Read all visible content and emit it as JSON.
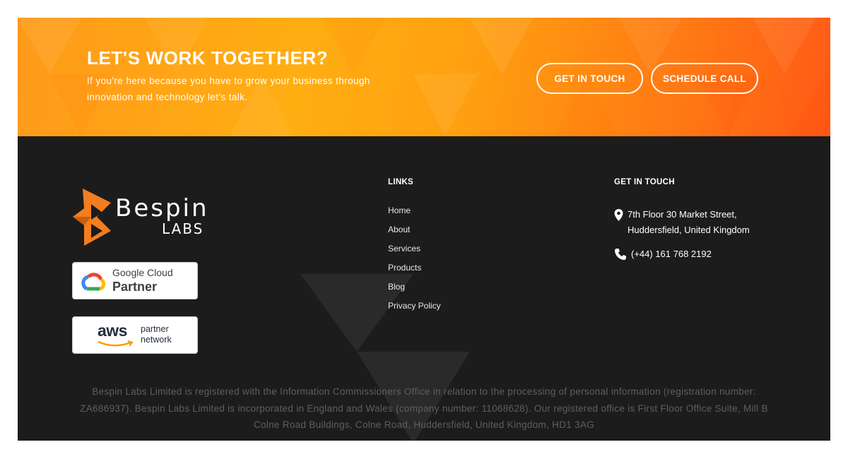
{
  "cta": {
    "title": "LET'S WORK TOGETHER?",
    "text": "If you're here because you have to grow your business through innovation and technology let's talk.",
    "button_touch": "GET IN TOUCH",
    "button_call": "SCHEDULE CALL"
  },
  "brand": {
    "name": "Bespin",
    "sub": "LABS",
    "accent": "#f47d20"
  },
  "badges": {
    "google_line1": "Google Cloud",
    "google_line2": "Partner",
    "aws_logo": "aws",
    "aws_line1": "partner",
    "aws_line2": "network"
  },
  "links": {
    "heading": "LINKS",
    "items": [
      "Home",
      "About",
      "Services",
      "Products",
      "Blog",
      "Privacy Policy"
    ]
  },
  "contact": {
    "heading": "GET IN TOUCH",
    "address": "7th Floor 30 Market Street, Huddersfield, United Kingdom",
    "phone": "(+44) 161 768 2192",
    "address_icon": "map-pin-icon",
    "phone_icon": "phone-icon"
  },
  "legal": "Bespin Labs Limited is registered with the Information Commissioners Office in relation to the processing of personal information (registration number: ZA686937). Bespin Labs Limited is incorporated in England and Wales (company number: 11068628). Our registered office is First Floor Office Suite, Mill B Colne Road Buildings, Colne Road, Huddersfield, United Kingdom, HD1 3AG"
}
